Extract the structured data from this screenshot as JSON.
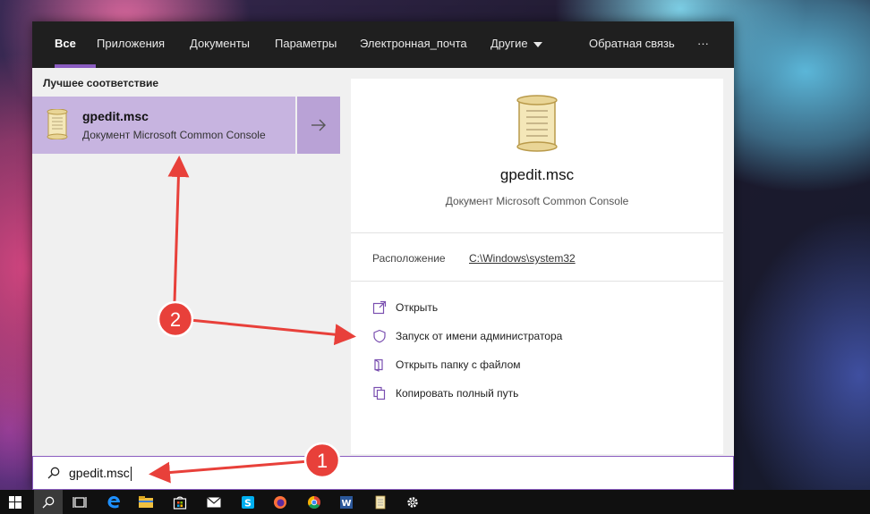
{
  "nav": {
    "tabs": [
      {
        "label": "Все"
      },
      {
        "label": "Приложения"
      },
      {
        "label": "Документы"
      },
      {
        "label": "Параметры"
      },
      {
        "label": "Электронная_почта"
      },
      {
        "label": "Другие"
      }
    ],
    "feedback_label": "Обратная связь",
    "more_label": "···"
  },
  "results": {
    "section_title": "Лучшее соответствие",
    "best": {
      "title": "gpedit.msc",
      "subtitle": "Документ Microsoft Common Console"
    }
  },
  "details": {
    "title": "gpedit.msc",
    "subtitle": "Документ Microsoft Common Console",
    "location_label": "Расположение",
    "location_value": "C:\\Windows\\system32",
    "actions": [
      {
        "label": "Открыть",
        "icon": "open-icon"
      },
      {
        "label": "Запуск от имени администратора",
        "icon": "shield-icon"
      },
      {
        "label": "Открыть папку с файлом",
        "icon": "folder-icon"
      },
      {
        "label": "Копировать полный путь",
        "icon": "copy-icon"
      }
    ]
  },
  "search": {
    "query": "gpedit.msc"
  },
  "annotations": {
    "badge1": "1",
    "badge2": "2",
    "color": "#e8403a"
  },
  "colors": {
    "accent": "#8a5cc0",
    "best_match_bg": "#c7b4e0",
    "nav_bg": "#1f1f1f"
  },
  "taskbar": {
    "items": [
      "windows-start-icon",
      "search-icon",
      "task-view-icon",
      "edge-icon",
      "file-explorer-icon",
      "store-icon",
      "mail-icon",
      "skype-icon",
      "firefox-icon",
      "chrome-icon",
      "word-icon",
      "notepad-doc-icon",
      "settings-gear-icon"
    ]
  }
}
